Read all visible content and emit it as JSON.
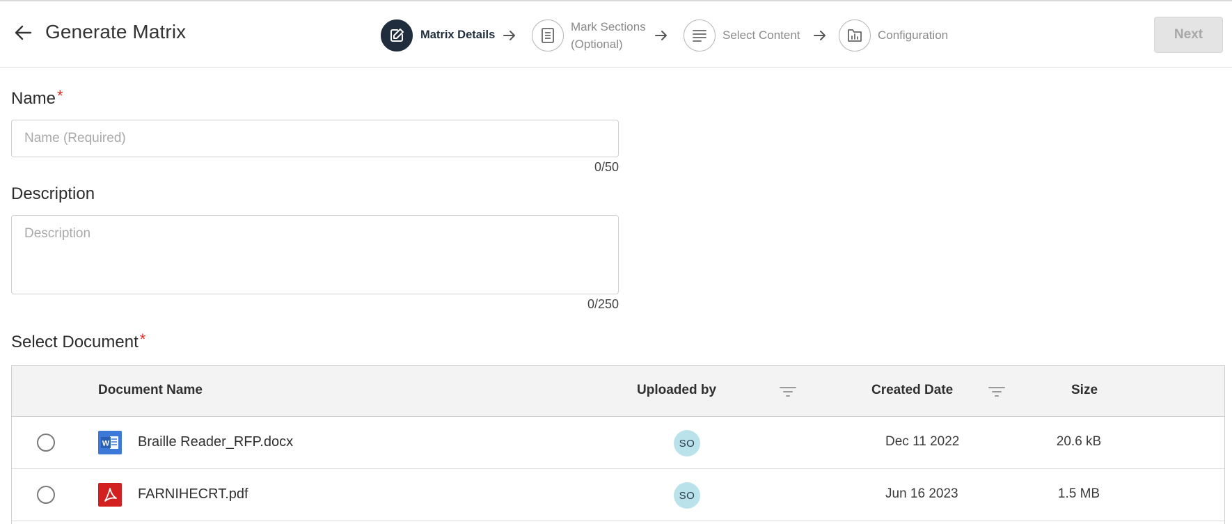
{
  "header": {
    "title": "Generate Matrix",
    "next_label": "Next"
  },
  "stepper": {
    "steps": [
      {
        "label": "Matrix Details",
        "state": "active",
        "icon": "edit-icon"
      },
      {
        "label_line1": "Mark Sections",
        "label_line2": "(Optional)",
        "state": "inactive",
        "icon": "document-icon"
      },
      {
        "label": "Select Content",
        "state": "inactive",
        "icon": "lines-icon"
      },
      {
        "label": "Configuration",
        "state": "inactive",
        "icon": "chart-folder-icon"
      }
    ]
  },
  "form": {
    "name": {
      "label": "Name",
      "required_mark": "*",
      "placeholder": "Name (Required)",
      "value": "",
      "counter": "0/50"
    },
    "description": {
      "label": "Description",
      "placeholder": "Description",
      "value": "",
      "counter": "0/250"
    },
    "select_document": {
      "label": "Select Document",
      "required_mark": "*"
    }
  },
  "table": {
    "columns": {
      "document_name": "Document Name",
      "uploaded_by": "Uploaded by",
      "created_date": "Created Date",
      "size": "Size"
    },
    "rows": [
      {
        "name": "Braille Reader_RFP.docx",
        "type": "word",
        "uploaded_by": "SO",
        "created_date": "Dec 11 2022",
        "size": "20.6 kB"
      },
      {
        "name": "FARNIHECRT.pdf",
        "type": "pdf",
        "uploaded_by": "SO",
        "created_date": "Jun 16 2023",
        "size": "1.5 MB"
      }
    ]
  },
  "colors": {
    "active_step": "#1f2d3d",
    "required": "#d93025",
    "word_icon": "#3b78d8",
    "pdf_icon": "#d22020",
    "avatar_bg": "#b9e2ea"
  }
}
